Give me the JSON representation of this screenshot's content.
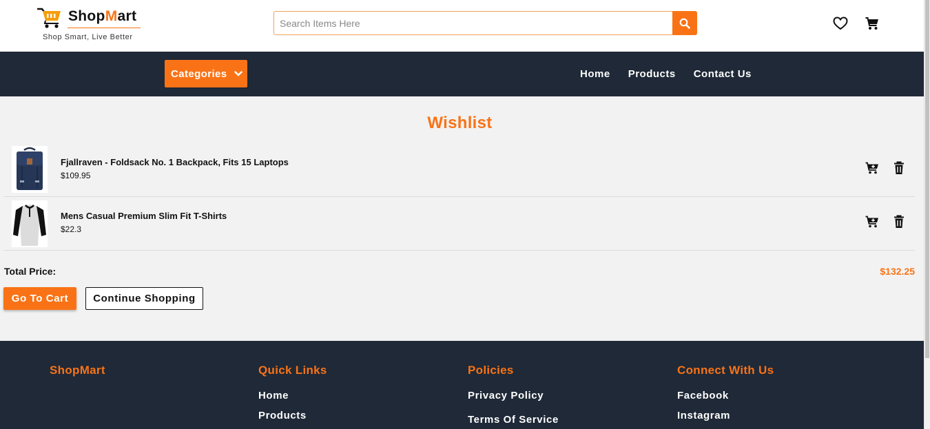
{
  "brand": {
    "name_prefix": "Shop",
    "name_m": "M",
    "name_suffix": "art",
    "tagline": "Shop Smart, Live Better",
    "accent_color": "#f97316",
    "dark_color": "#1f2937"
  },
  "search": {
    "placeholder": "Search Items Here",
    "value": "",
    "button_icon": "search-icon"
  },
  "header_icons": [
    "heart-icon",
    "cart-icon"
  ],
  "nav": {
    "categories_label": "Categories",
    "links": [
      "Home",
      "Products",
      "Contact Us"
    ]
  },
  "wishlist": {
    "title": "Wishlist",
    "items": [
      {
        "name": "Fjallraven - Foldsack No. 1 Backpack, Fits 15 Laptops",
        "price": "$109.95",
        "image": "backpack"
      },
      {
        "name": "Mens Casual Premium Slim Fit T-Shirts",
        "price": "$22.3",
        "image": "t-shirt"
      }
    ],
    "item_actions": [
      "add-to-cart-icon",
      "trash-icon"
    ],
    "total_label": "Total Price:",
    "total_value": "$132.25",
    "go_to_cart_label": "Go To Cart",
    "continue_label": "Continue Shopping"
  },
  "footer": {
    "brand": "ShopMart",
    "quick_links": {
      "heading": "Quick Links",
      "links": [
        "Home",
        "Products"
      ]
    },
    "policies": {
      "heading": "Policies",
      "links": [
        "Privacy Policy",
        "Terms Of Service"
      ]
    },
    "connect": {
      "heading": "Connect With Us",
      "links": [
        "Facebook",
        "Instagram"
      ]
    }
  }
}
